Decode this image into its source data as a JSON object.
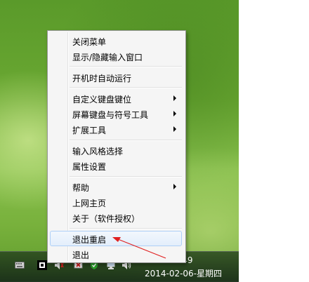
{
  "context_menu": {
    "items": [
      {
        "label": "关闭菜单"
      },
      {
        "label": "显示/隐藏输入窗口"
      },
      {
        "label": "开机时自动运行"
      },
      {
        "label": "自定义键盘键位"
      },
      {
        "label": "屏幕键盘与符号工具"
      },
      {
        "label": "扩展工具"
      },
      {
        "label": "输入风格选择"
      },
      {
        "label": "属性设置"
      },
      {
        "label": "帮助"
      },
      {
        "label": "上网主页"
      },
      {
        "label": "关于（软件授权）"
      },
      {
        "label": "退出重启"
      },
      {
        "label": "退出"
      }
    ]
  },
  "taskbar": {
    "time": "9:49",
    "date": "2014-02-06-星期四",
    "tray_icons": [
      "keyboard-icon",
      "input-method-icon",
      "volume-icon",
      "flag-icon",
      "shield-icon",
      "network-icon",
      "speaker-icon"
    ]
  },
  "colors": {
    "menu_background": "#f5f5f5",
    "highlight_border": "#aecff7",
    "annotation_arrow": "#e02020"
  }
}
